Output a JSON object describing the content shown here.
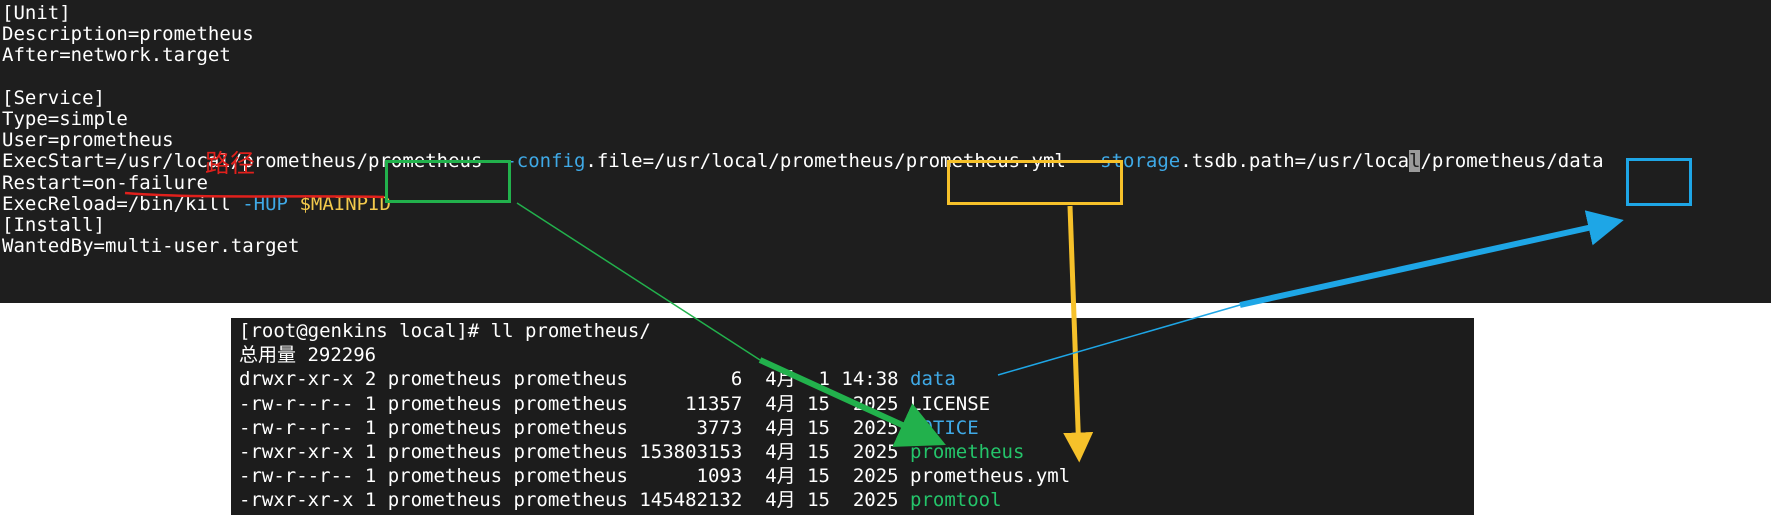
{
  "annotation": {
    "label": "路径"
  },
  "colors": {
    "terminal_bg": "#1e1e1e",
    "text": "#ffffff",
    "option_blue": "#3fa9e6",
    "variable_yellow": "#f2c94c",
    "executable_green": "#24c46a",
    "annotation_red": "#e0201c",
    "box_green": "#22b14c",
    "box_yellow": "#f6c12a",
    "box_blue": "#1ea6e6"
  },
  "service_file": {
    "lines": [
      [
        {
          "t": "[Unit]",
          "c": "w"
        }
      ],
      [
        {
          "t": "Description=prometheus",
          "c": "w"
        }
      ],
      [
        {
          "t": "After=network.target",
          "c": "w"
        }
      ],
      [],
      [
        {
          "t": "[Service]",
          "c": "w"
        }
      ],
      [
        {
          "t": "Type=simple",
          "c": "w"
        }
      ],
      [
        {
          "t": "User=prometheus",
          "c": "w"
        }
      ],
      [
        {
          "t": "ExecStart=/usr/local/prometheus/prometheus ",
          "c": "w"
        },
        {
          "t": "--config",
          "c": "b"
        },
        {
          "t": ".file=/usr/local/prometheus/prometheus.yml ",
          "c": "w"
        },
        {
          "t": "--storage",
          "c": "b"
        },
        {
          "t": ".tsdb.path=/usr/loca",
          "c": "w"
        },
        {
          "t": "l",
          "c": "hl"
        },
        {
          "t": "/prometheus/data",
          "c": "w"
        }
      ],
      [
        {
          "t": "Restart=on-failure",
          "c": "w"
        }
      ],
      [
        {
          "t": "ExecReload=/bin/kill ",
          "c": "w"
        },
        {
          "t": "-HUP",
          "c": "b"
        },
        {
          "t": " ",
          "c": "w"
        },
        {
          "t": "$MAINPID",
          "c": "y"
        }
      ],
      [
        {
          "t": "[Install]",
          "c": "w"
        }
      ],
      [
        {
          "t": "WantedBy=multi-user.target",
          "c": "w"
        }
      ]
    ]
  },
  "listing": {
    "lines": [
      [
        {
          "t": "[root@genkins local]# ll prometheus/",
          "c": "w"
        }
      ],
      [
        {
          "t": "总用量 292296",
          "c": "w"
        }
      ],
      [
        {
          "t": "drwxr-xr-x 2 prometheus prometheus         6  4月  1 14:38 ",
          "c": "w"
        },
        {
          "t": "data",
          "c": "b"
        }
      ],
      [
        {
          "t": "-rw-r--r-- 1 prometheus prometheus     11357  4月 15  2025 ",
          "c": "w"
        },
        {
          "t": "LICENSE",
          "c": "w"
        }
      ],
      [
        {
          "t": "-rw-r--r-- 1 prometheus prometheus      3773  4月 15  2025 ",
          "c": "w"
        },
        {
          "t": "NOTICE",
          "c": "b"
        }
      ],
      [
        {
          "t": "-rwxr-xr-x 1 prometheus prometheus 153803153  4月 15  2025 ",
          "c": "w"
        },
        {
          "t": "prometheus",
          "c": "g"
        }
      ],
      [
        {
          "t": "-rw-r--r-- 1 prometheus prometheus      1093  4月 15  2025 ",
          "c": "w"
        },
        {
          "t": "prometheus.yml",
          "c": "w"
        }
      ],
      [
        {
          "t": "-rwxr-xr-x 1 prometheus prometheus 145482132  4月 15  2025 ",
          "c": "w"
        },
        {
          "t": "promtool",
          "c": "g"
        }
      ]
    ]
  }
}
